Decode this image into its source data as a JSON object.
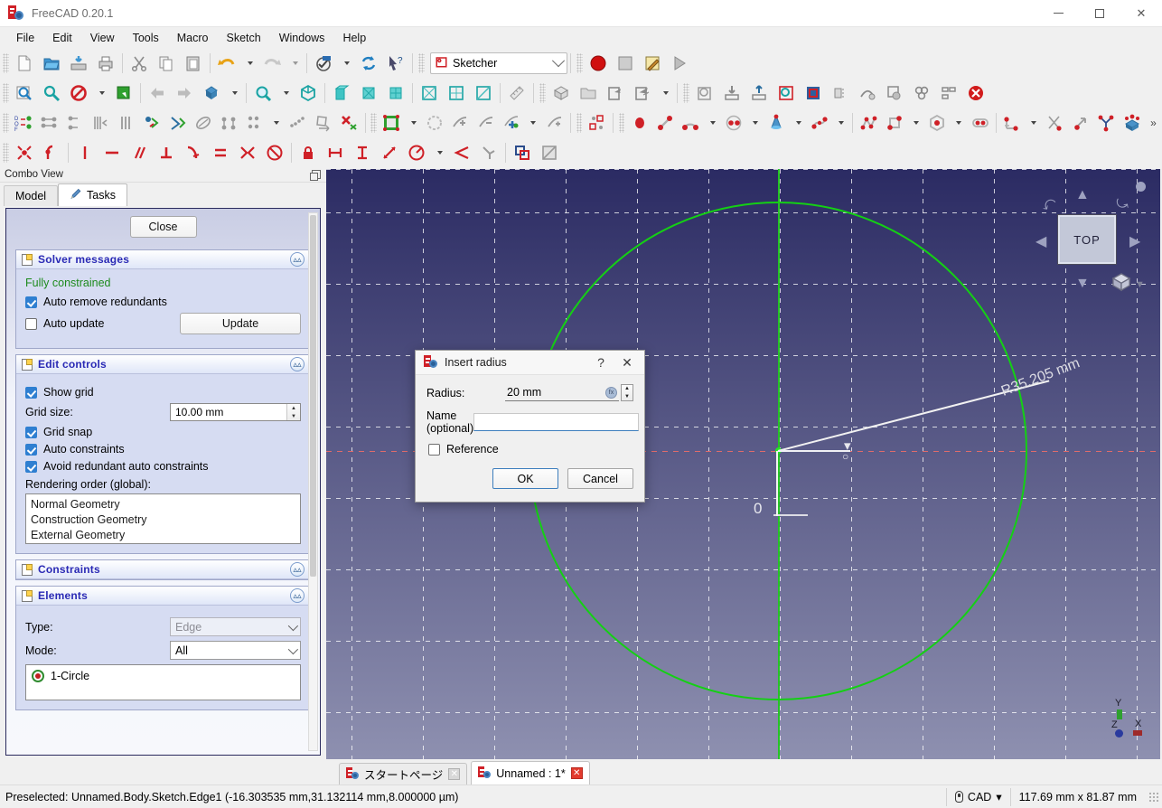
{
  "window": {
    "title": "FreeCAD 0.20.1",
    "minimize": "—",
    "maximize": "□",
    "close": "✕"
  },
  "menubar": {
    "items": [
      "File",
      "Edit",
      "View",
      "Tools",
      "Macro",
      "Sketch",
      "Windows",
      "Help"
    ]
  },
  "workbench": {
    "selected": "Sketcher"
  },
  "combo_view": {
    "dock_title": "Combo View",
    "tabs": [
      {
        "label": "Model",
        "active": false
      },
      {
        "label": "Tasks",
        "active": true
      }
    ],
    "close_label": "Close",
    "solver": {
      "title": "Solver messages",
      "status": "Fully constrained",
      "auto_remove_redundants": {
        "label": "Auto remove redundants",
        "checked": true
      },
      "auto_update": {
        "label": "Auto update",
        "checked": false
      },
      "update_label": "Update"
    },
    "edit_controls": {
      "title": "Edit controls",
      "show_grid": {
        "label": "Show grid",
        "checked": true
      },
      "grid_size_label": "Grid size:",
      "grid_size_value": "10.00 mm",
      "grid_snap": {
        "label": "Grid snap",
        "checked": true
      },
      "auto_constraints": {
        "label": "Auto constraints",
        "checked": true
      },
      "avoid_redundant": {
        "label": "Avoid redundant auto constraints",
        "checked": true
      },
      "rendering_order_label": "Rendering order (global):",
      "rendering_order_items": [
        "Normal Geometry",
        "Construction Geometry",
        "External Geometry"
      ]
    },
    "constraints": {
      "title": "Constraints"
    },
    "elements": {
      "title": "Elements",
      "type_label": "Type:",
      "type_value": "Edge",
      "mode_label": "Mode:",
      "mode_value": "All",
      "items": [
        "1-Circle"
      ]
    }
  },
  "viewport": {
    "radius_label": "R35.205 mm",
    "zero_label": "0",
    "navcube_face": "TOP",
    "axis_labels": {
      "x": "X",
      "y": "Y",
      "z": "Z"
    }
  },
  "dialog": {
    "title": "Insert radius",
    "help_glyph": "?",
    "close_glyph": "✕",
    "radius_label": "Radius:",
    "radius_value": "20 mm",
    "name_label": "Name (optional)",
    "name_value": "",
    "name_placeholder": "",
    "reference_label": "Reference",
    "reference_checked": false,
    "ok_label": "OK",
    "cancel_label": "Cancel"
  },
  "mdi_tabs": [
    {
      "label": "スタートページ",
      "active": false,
      "close_glyph": "✕"
    },
    {
      "label": "Unnamed : 1*",
      "active": true,
      "close_glyph": "✕"
    }
  ],
  "status_bar": {
    "message": "Preselected: Unnamed.Body.Sketch.Edge1 (-16.303535 mm,31.132114 mm,8.000000 µm)",
    "nav_style": "CAD",
    "nav_caret": "▾",
    "dimensions": "117.69 mm x 81.87 mm"
  },
  "colors": {
    "accent_blue": "#2a2ab5",
    "constrained_green": "#1d8a1d",
    "sketch_green": "#14d014",
    "viewport_top": "#2b2b63",
    "viewport_bottom": "#8e90b0",
    "selection_blue": "#2f7fd1"
  }
}
